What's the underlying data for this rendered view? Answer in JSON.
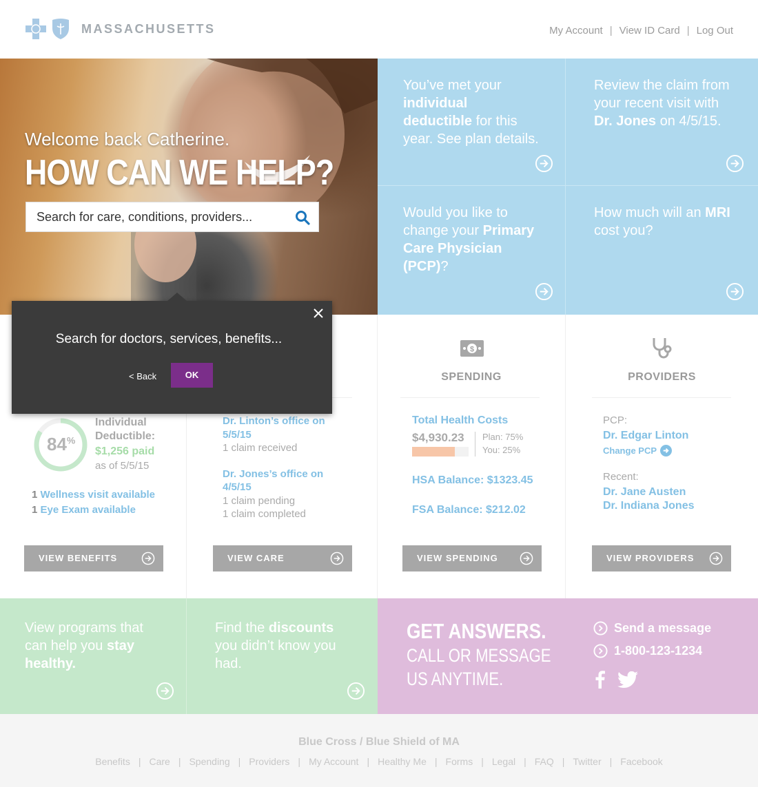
{
  "brand": {
    "name": "MASSACHUSETTS"
  },
  "topnav": {
    "my_account": "My Account",
    "view_id": "View ID Card",
    "logout": "Log Out",
    "sep": "|"
  },
  "hero": {
    "welcome": "Welcome back Catherine.",
    "headline": "HOW CAN WE HELP?",
    "search_placeholder": "Search for care, conditions, providers..."
  },
  "tiles": {
    "t1": {
      "a": "You’ve met your ",
      "b": "individual deductible",
      "c": " for this year. See plan details."
    },
    "t2": {
      "a": "Review the claim from your recent visit with ",
      "b": "Dr. Jones",
      "c": " on 4/5/15."
    },
    "t3": {
      "a": "Would you like to change your ",
      "b": "Primary Care Physician (PCP)",
      "c": "?"
    },
    "t4": {
      "a": "How much will an ",
      "b": "MRI",
      "c": " cost you?"
    }
  },
  "popup": {
    "text": "Search for doctors, services, benefits...",
    "back": "< Back",
    "ok": "OK"
  },
  "benefits": {
    "percent": "84",
    "percent_sign": "%",
    "progress": 0.84,
    "label1": "Individual",
    "label2": "Deductible:",
    "paid": "$1,256 paid",
    "asof": "as of 5/5/15",
    "item1_count": "1",
    "item1": "Wellness visit available",
    "item2_count": "1",
    "item2": "Eye Exam available",
    "button": "VIEW BENEFITS"
  },
  "care": {
    "claim1_title": "Dr. Linton’s office on 5/5/15",
    "claim1_status": "1 claim received",
    "claim2_title": "Dr. Jones’s office on 4/5/15",
    "claim2_status1": "1 claim pending",
    "claim2_status2": "1 claim completed",
    "button": "VIEW CARE"
  },
  "spending": {
    "title": "SPENDING",
    "total_label": "Total Health Costs",
    "total": "$4,930.23",
    "plan": "Plan: 75%",
    "you": "You: 25%",
    "plan_share": 0.75,
    "hsa": "HSA Balance: $1323.45",
    "fsa": "FSA Balance: $212.02",
    "button": "VIEW SPENDING"
  },
  "providers": {
    "title": "PROVIDERS",
    "pcp_label": "PCP:",
    "pcp": "Dr. Edgar Linton",
    "change_pcp": "Change PCP",
    "recent_label": "Recent:",
    "recent1": "Dr. Jane Austen",
    "recent2": "Dr. Indiana Jones",
    "button": "VIEW PROVIDERS"
  },
  "bottom": {
    "g1": {
      "a": "View programs that can help you ",
      "b": "stay healthy."
    },
    "g2": {
      "a": "Find the ",
      "b": "discounts",
      "c": " you didn’t know you had."
    },
    "answers_title": "GET ANSWERS.",
    "answers_sub1": "CALL OR MESSAGE",
    "answers_sub2": "US ANYTIME.",
    "message": "Send a message",
    "phone": "1-800-123-1234"
  },
  "footer": {
    "title": "Blue Cross / Blue Shield of MA",
    "links": [
      "Benefits",
      "Care",
      "Spending",
      "Providers",
      "My Account",
      "Healthy Me",
      "Forms",
      "Legal",
      "FAQ",
      "Twitter",
      "Facebook"
    ]
  },
  "colors": {
    "tile_blue": "#afd9ee",
    "green": "#c5e8cb",
    "purple": "#dfbcdc",
    "ok_purple": "#7b2e8a",
    "link_blue": "#83c0e4"
  }
}
